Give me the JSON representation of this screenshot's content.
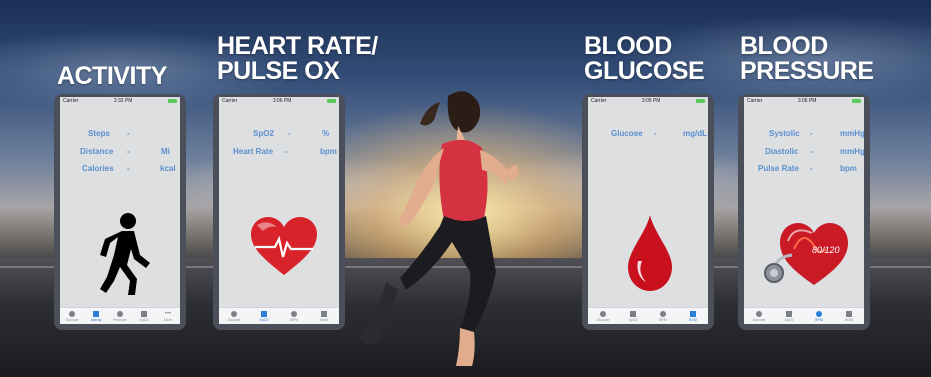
{
  "sections": {
    "activity": {
      "heading": "ACTIVITY",
      "status": {
        "carrier": "Carrier",
        "time": "2:32 PM"
      },
      "rows": [
        {
          "label": "Steps",
          "value": "-",
          "unit": ""
        },
        {
          "label": "Distance",
          "value": "-",
          "unit": "Mi"
        },
        {
          "label": "Calories",
          "value": "-",
          "unit": "kcal"
        }
      ],
      "tabs": [
        "Glucose",
        "Activity",
        "Pressure",
        "SpO2",
        "More"
      ],
      "active_tab": 1,
      "icon": "walking-person-icon"
    },
    "heart": {
      "heading": "HEART RATE/\nPULSE OX",
      "status": {
        "carrier": "Carrier",
        "time": "3:06 PM"
      },
      "rows": [
        {
          "label": "SpO2",
          "value": "-",
          "unit": "%"
        },
        {
          "label": "Heart Rate",
          "value": "-",
          "unit": "bpm"
        }
      ],
      "tabs": [
        "Glucose",
        "SpO2",
        "BPM",
        "More"
      ],
      "active_tab": 1,
      "icon": "heart-pulse-icon"
    },
    "glucose": {
      "heading": "BLOOD\nGLUCOSE",
      "status": {
        "carrier": "Carrier",
        "time": "3:05 PM"
      },
      "rows": [
        {
          "label": "Glucose",
          "value": "-",
          "unit": "mg/dL"
        }
      ],
      "tabs": [
        "Glucose",
        "SpO2",
        "BPM",
        "BGM"
      ],
      "active_tab": 3,
      "icon": "blood-drop-icon"
    },
    "pressure": {
      "heading": "BLOOD\nPRESSURE",
      "status": {
        "carrier": "Carrier",
        "time": "3:06 PM"
      },
      "rows": [
        {
          "label": "Systolic",
          "value": "-",
          "unit": "mmHg"
        },
        {
          "label": "Diastolic",
          "value": "-",
          "unit": "mmHg"
        },
        {
          "label": "Pulse Rate",
          "value": "-",
          "unit": "bpm"
        }
      ],
      "tabs": [
        "Glucose",
        "SpO2",
        "BPM",
        "BGM"
      ],
      "active_tab": 2,
      "icon": "heart-gauge-icon",
      "gauge_text": "80/120"
    }
  },
  "colors": {
    "accent": "#2a7fd8",
    "label": "#5b8fd0",
    "heart": "#d8232a",
    "drop": "#c8101e"
  }
}
